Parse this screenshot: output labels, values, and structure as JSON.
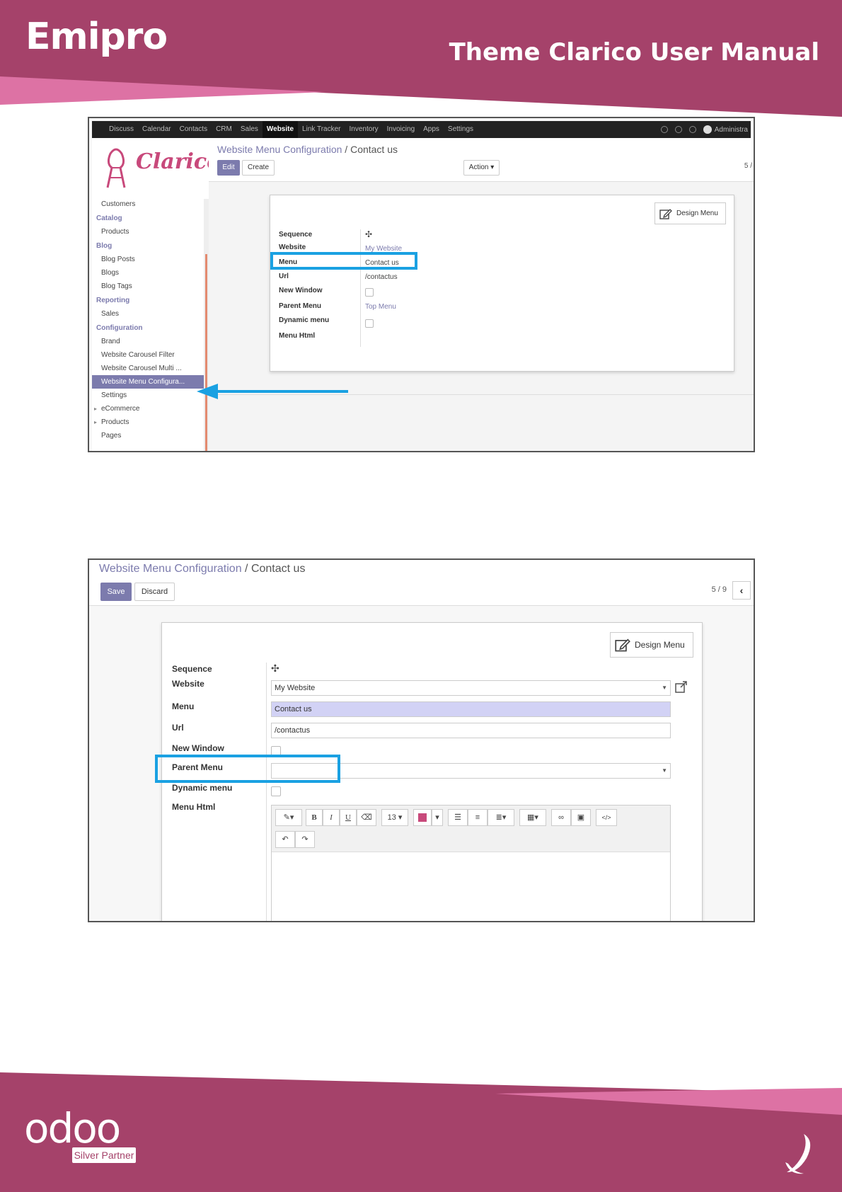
{
  "header": {
    "brand": "Emipro",
    "title": "Theme Clarico User Manual",
    "colors": {
      "primary": "#a5426a",
      "accent": "#dd72a4"
    }
  },
  "footer": {
    "logo_text": "odoo",
    "partner_badge": "Silver Partner",
    "right_mark_icon": "emipro-swirl-icon"
  },
  "shot1": {
    "topnav": [
      "Discuss",
      "Calendar",
      "Contacts",
      "CRM",
      "Sales",
      "Website",
      "Link Tracker",
      "Inventory",
      "Invoicing",
      "Apps",
      "Settings"
    ],
    "topnav_active": "Website",
    "user": "Administra",
    "logo_text": "Clarico",
    "sidebar": {
      "customers": "Customers",
      "catalog": "Catalog",
      "products": "Products",
      "blog": "Blog",
      "blog_posts": "Blog Posts",
      "blogs": "Blogs",
      "blog_tags": "Blog Tags",
      "reporting": "Reporting",
      "sales": "Sales",
      "configuration": "Configuration",
      "brand": "Brand",
      "carousel_filter": "Website Carousel Filter",
      "carousel_multi": "Website Carousel Multi ...",
      "menu_config": "Website Menu Configura...",
      "settings": "Settings",
      "ecommerce": "eCommerce",
      "products2": "Products",
      "pages": "Pages"
    },
    "breadcrumb_parent": "Website Menu Configuration",
    "breadcrumb_sep": "/",
    "breadcrumb_current": "Contact us",
    "edit_label": "Edit",
    "create_label": "Create",
    "action_label": "Action ▾",
    "pager": "5 /",
    "design_menu_label": "Design Menu",
    "fields": {
      "sequence": "Sequence",
      "website": "Website",
      "menu": "Menu",
      "url": "Url",
      "new_window": "New Window",
      "parent_menu": "Parent Menu",
      "dynamic_menu": "Dynamic menu",
      "menu_html": "Menu Html"
    },
    "values": {
      "website": "My Website",
      "menu": "Contact us",
      "url": "/contactus",
      "parent_menu": "Top Menu"
    }
  },
  "shot2": {
    "breadcrumb_parent": "Website Menu Configuration",
    "breadcrumb_sep": "/",
    "breadcrumb_current": "Contact us",
    "save_label": "Save",
    "discard_label": "Discard",
    "pager": "5 / 9",
    "design_menu_label": "Design Menu",
    "fields": {
      "sequence": "Sequence",
      "website": "Website",
      "menu": "Menu",
      "url": "Url",
      "new_window": "New Window",
      "parent_menu": "Parent Menu",
      "dynamic_menu": "Dynamic menu",
      "menu_html": "Menu Html"
    },
    "values": {
      "website": "My Website",
      "menu": "Contact us",
      "url": "/contactus",
      "parent_menu": ""
    },
    "toolbar": {
      "bold": "B",
      "italic": "I",
      "underline": "U",
      "font_size": "13 ▾"
    }
  },
  "highlight_color": "#1aa1e2"
}
